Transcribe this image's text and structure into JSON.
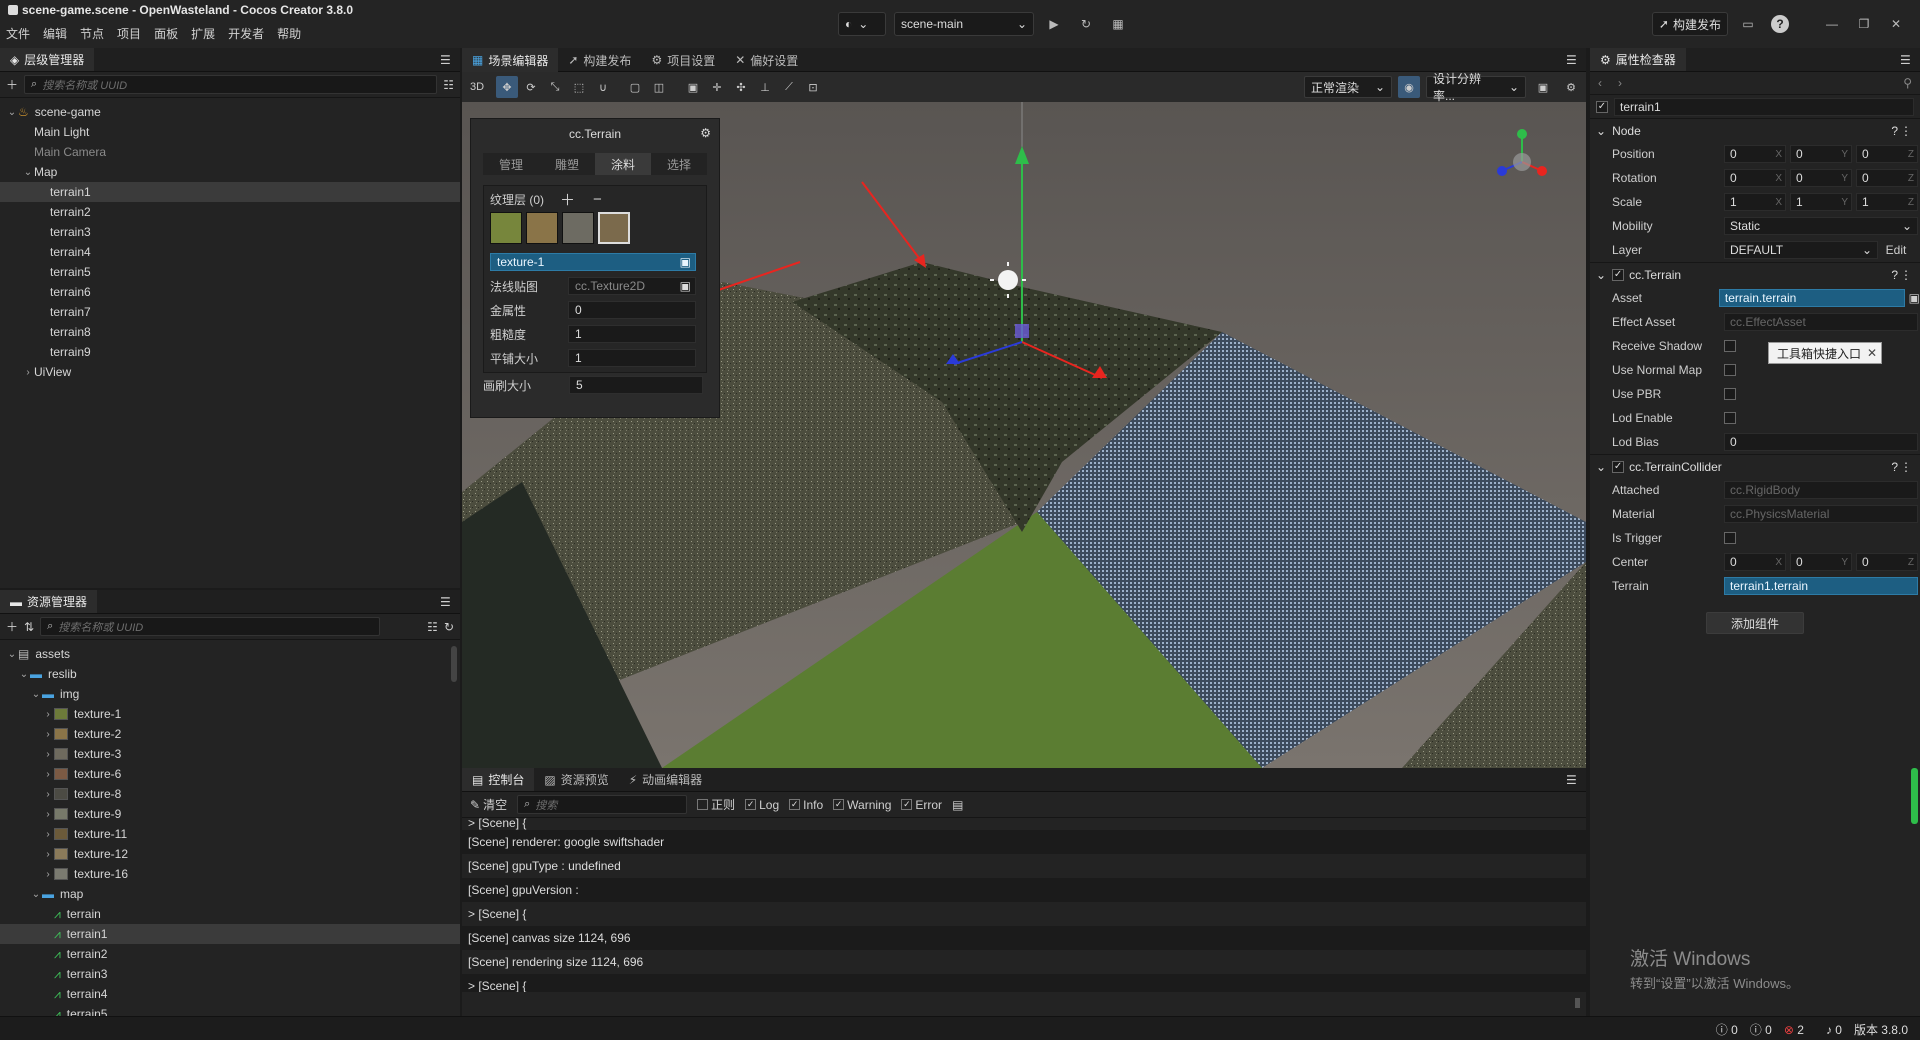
{
  "app": {
    "title": "scene-game.scene - OpenWasteland - Cocos Creator 3.8.0",
    "menu": [
      "文件",
      "编辑",
      "节点",
      "项目",
      "面板",
      "扩展",
      "开发者",
      "帮助"
    ],
    "scene_select": "scene-main",
    "publish_label": "构建发布"
  },
  "hierarchy": {
    "tab": "层级管理器",
    "search_placeholder": "搜索名称或 UUID",
    "nodes": [
      {
        "label": "scene-game",
        "depth": 0,
        "arrow": "v"
      },
      {
        "label": "Main Light",
        "depth": 1,
        "arrow": ""
      },
      {
        "label": "Main Camera",
        "depth": 1,
        "arrow": ""
      },
      {
        "label": "Map",
        "depth": 1,
        "arrow": "v"
      },
      {
        "label": "terrain1",
        "depth": 2,
        "arrow": ""
      },
      {
        "label": "terrain2",
        "depth": 2,
        "arrow": ""
      },
      {
        "label": "terrain3",
        "depth": 2,
        "arrow": ""
      },
      {
        "label": "terrain4",
        "depth": 2,
        "arrow": ""
      },
      {
        "label": "terrain5",
        "depth": 2,
        "arrow": ""
      },
      {
        "label": "terrain6",
        "depth": 2,
        "arrow": ""
      },
      {
        "label": "terrain7",
        "depth": 2,
        "arrow": ""
      },
      {
        "label": "terrain8",
        "depth": 2,
        "arrow": ""
      },
      {
        "label": "terrain9",
        "depth": 2,
        "arrow": ""
      },
      {
        "label": "UiView",
        "depth": 1,
        "arrow": ">"
      }
    ]
  },
  "assets": {
    "tab": "资源管理器",
    "search_placeholder": "搜索名称或 UUID",
    "items": [
      {
        "label": "assets",
        "depth": 0,
        "arrow": "v"
      },
      {
        "label": "reslib",
        "depth": 1,
        "arrow": "v"
      },
      {
        "label": "img",
        "depth": 2,
        "arrow": "v"
      },
      {
        "label": "texture-1",
        "depth": 3,
        "arrow": ">"
      },
      {
        "label": "texture-2",
        "depth": 3,
        "arrow": ">"
      },
      {
        "label": "texture-3",
        "depth": 3,
        "arrow": ">"
      },
      {
        "label": "texture-6",
        "depth": 3,
        "arrow": ">"
      },
      {
        "label": "texture-8",
        "depth": 3,
        "arrow": ">"
      },
      {
        "label": "texture-9",
        "depth": 3,
        "arrow": ">"
      },
      {
        "label": "texture-11",
        "depth": 3,
        "arrow": ">"
      },
      {
        "label": "texture-12",
        "depth": 3,
        "arrow": ">"
      },
      {
        "label": "texture-16",
        "depth": 3,
        "arrow": ">"
      },
      {
        "label": "map",
        "depth": 2,
        "arrow": "v"
      },
      {
        "label": "terrain",
        "depth": 3,
        "arrow": ""
      },
      {
        "label": "terrain1",
        "depth": 3,
        "arrow": ""
      },
      {
        "label": "terrain2",
        "depth": 3,
        "arrow": ""
      },
      {
        "label": "terrain3",
        "depth": 3,
        "arrow": ""
      },
      {
        "label": "terrain4",
        "depth": 3,
        "arrow": ""
      },
      {
        "label": "terrain5",
        "depth": 3,
        "arrow": ""
      }
    ]
  },
  "scene_tabs": [
    "场景编辑器",
    "构建发布",
    "项目设置",
    "偏好设置"
  ],
  "scene_toolbar": {
    "mode": "3D",
    "render": "正常渲染",
    "resolution": "设计分辨率..."
  },
  "terrain_panel": {
    "title": "cc.Terrain",
    "tabs": [
      "管理",
      "雕塑",
      "涂料",
      "选择"
    ],
    "layers_label": "纹理层 (0)",
    "layer_name": "texture-1",
    "fields": [
      {
        "label": "法线贴图",
        "value": "cc.Texture2D"
      },
      {
        "label": "金属性",
        "value": "0"
      },
      {
        "label": "粗糙度",
        "value": "1"
      },
      {
        "label": "平铺大小",
        "value": "1"
      }
    ],
    "brush_label": "画刷大小",
    "brush_value": "5"
  },
  "console": {
    "tabs": [
      "控制台",
      "资源预览",
      "动画编辑器"
    ],
    "clear": "清空",
    "search_placeholder": "搜索",
    "filters": [
      {
        "label": "正则",
        "checked": false
      },
      {
        "label": "Log",
        "checked": true
      },
      {
        "label": "Info",
        "checked": true
      },
      {
        "label": "Warning",
        "checked": true
      },
      {
        "label": "Error",
        "checked": true
      }
    ],
    "lines": [
      "> [Scene] {",
      "[Scene] renderer: google swiftshader",
      "[Scene] gpuType : undefined",
      "[Scene] gpuVersion :",
      "> [Scene] {",
      "[Scene] canvas size 1124, 696",
      "[Scene] rendering size 1124, 696",
      "> [Scene] {"
    ]
  },
  "inspector": {
    "tab": "属性检查器",
    "node_name": "terrain1",
    "node_section": "Node",
    "position": [
      "0",
      "0",
      "0"
    ],
    "rotation": [
      "0",
      "0",
      "0"
    ],
    "scale": [
      "1",
      "1",
      "1"
    ],
    "mobility": "Static",
    "layer": "DEFAULT",
    "edit": "Edit",
    "terrain_section": "cc.Terrain",
    "asset": "terrain.terrain",
    "effect_asset": "cc.EffectAsset",
    "lod_bias": "0",
    "collider_section": "cc.TerrainCollider",
    "attached": "cc.RigidBody",
    "material": "cc.PhysicsMaterial",
    "center": [
      "0",
      "0",
      "0"
    ],
    "terrain_ref": "terrain1.terrain",
    "add_component": "添加组件",
    "tooltip": "工具箱快捷入口",
    "labels": {
      "position": "Position",
      "rotation": "Rotation",
      "scale": "Scale",
      "mobility": "Mobility",
      "layer": "Layer",
      "asset": "Asset",
      "effect": "Effect Asset",
      "receive_shadow": "Receive Shadow",
      "use_normal_map": "Use Normal Map",
      "use_pbr": "Use PBR",
      "lod_enable": "Lod Enable",
      "lod_bias": "Lod Bias",
      "attached": "Attached",
      "material": "Material",
      "is_trigger": "Is Trigger",
      "center": "Center",
      "terrain": "Terrain"
    }
  },
  "watermark": {
    "line1": "激活 Windows",
    "line2": "转到“设置”以激活 Windows。"
  },
  "status": {
    "c1": "0",
    "c2": "0",
    "errors": "2",
    "notices": "0",
    "version": "版本 3.8.0"
  },
  "colors": {
    "accent": "#1d5e82",
    "selection": "#3b3b3b",
    "grass": "#5b7d32",
    "arrow": "#e8251f"
  }
}
